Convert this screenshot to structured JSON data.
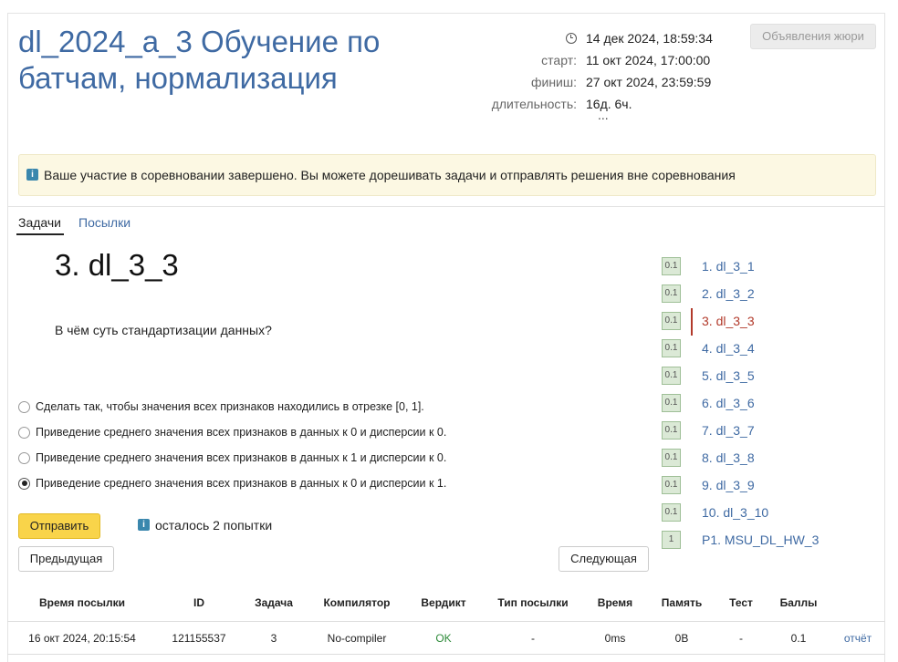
{
  "contest": {
    "title": "dl_2024_a_3 Обучение по батчам, нормализация",
    "current_time": "14 дек 2024, 18:59:34",
    "start_label": "старт:",
    "start_value": "11 окт 2024, 17:00:00",
    "finish_label": "финиш:",
    "finish_value": "27 окт 2024, 23:59:59",
    "duration_label": "длительность:",
    "duration_value": "16д. 6ч.",
    "ellipsis": "...",
    "jury_button": "Объявления жюри"
  },
  "alert": {
    "icon": "info-icon",
    "text": "Ваше участие в соревновании завершено. Вы можете дорешивать задачи и отправлять решения вне соревнования"
  },
  "tabs": [
    {
      "label": "Задачи",
      "active": true
    },
    {
      "label": "Посылки",
      "active": false
    }
  ],
  "task": {
    "title": "3. dl_3_3",
    "question": "В чём суть стандартизации данных?",
    "options": [
      {
        "label": "Сделать так, чтобы значения всех признаков находились в отрезке [0, 1].",
        "checked": false
      },
      {
        "label": "Приведение среднего значения всех признаков в данных к 0 и дисперсии к 0.",
        "checked": false
      },
      {
        "label": "Приведение среднего значения всех признаков в данных к 1 и дисперсии к 0.",
        "checked": false
      },
      {
        "label": "Приведение среднего значения всех признаков в данных к 0 и дисперсии к 1.",
        "checked": true
      }
    ],
    "submit_button": "Отправить",
    "attempts_text": "осталось 2 попытки",
    "prev_button": "Предыдущая",
    "next_button": "Следующая"
  },
  "task_list": [
    {
      "badge": "0.1",
      "label": "1. dl_3_1",
      "active": false
    },
    {
      "badge": "0.1",
      "label": "2. dl_3_2",
      "active": false
    },
    {
      "badge": "0.1",
      "label": "3. dl_3_3",
      "active": true
    },
    {
      "badge": "0.1",
      "label": "4. dl_3_4",
      "active": false
    },
    {
      "badge": "0.1",
      "label": "5. dl_3_5",
      "active": false
    },
    {
      "badge": "0.1",
      "label": "6. dl_3_6",
      "active": false
    },
    {
      "badge": "0.1",
      "label": "7. dl_3_7",
      "active": false
    },
    {
      "badge": "0.1",
      "label": "8. dl_3_8",
      "active": false
    },
    {
      "badge": "0.1",
      "label": "9. dl_3_9",
      "active": false
    },
    {
      "badge": "0.1",
      "label": "10. dl_3_10",
      "active": false
    },
    {
      "badge": "1",
      "label": "P1. MSU_DL_HW_3",
      "active": false
    }
  ],
  "submissions": {
    "headers": [
      "Время посылки",
      "ID",
      "Задача",
      "Компилятор",
      "Вердикт",
      "Тип посылки",
      "Время",
      "Память",
      "Тест",
      "Баллы",
      ""
    ],
    "rows": [
      [
        "16 окт 2024, 20:15:54",
        "121155537",
        "3",
        "No-compiler",
        "OK",
        "-",
        "0ms",
        "0B",
        "-",
        "0.1",
        "отчёт"
      ]
    ]
  },
  "colors": {
    "title_blue": "#3f6aa3",
    "alert_bg": "#fcf8e3",
    "submit_yellow": "#f9d44a",
    "active_red": "#b23a2b",
    "ok_green": "#2e8b3a"
  }
}
